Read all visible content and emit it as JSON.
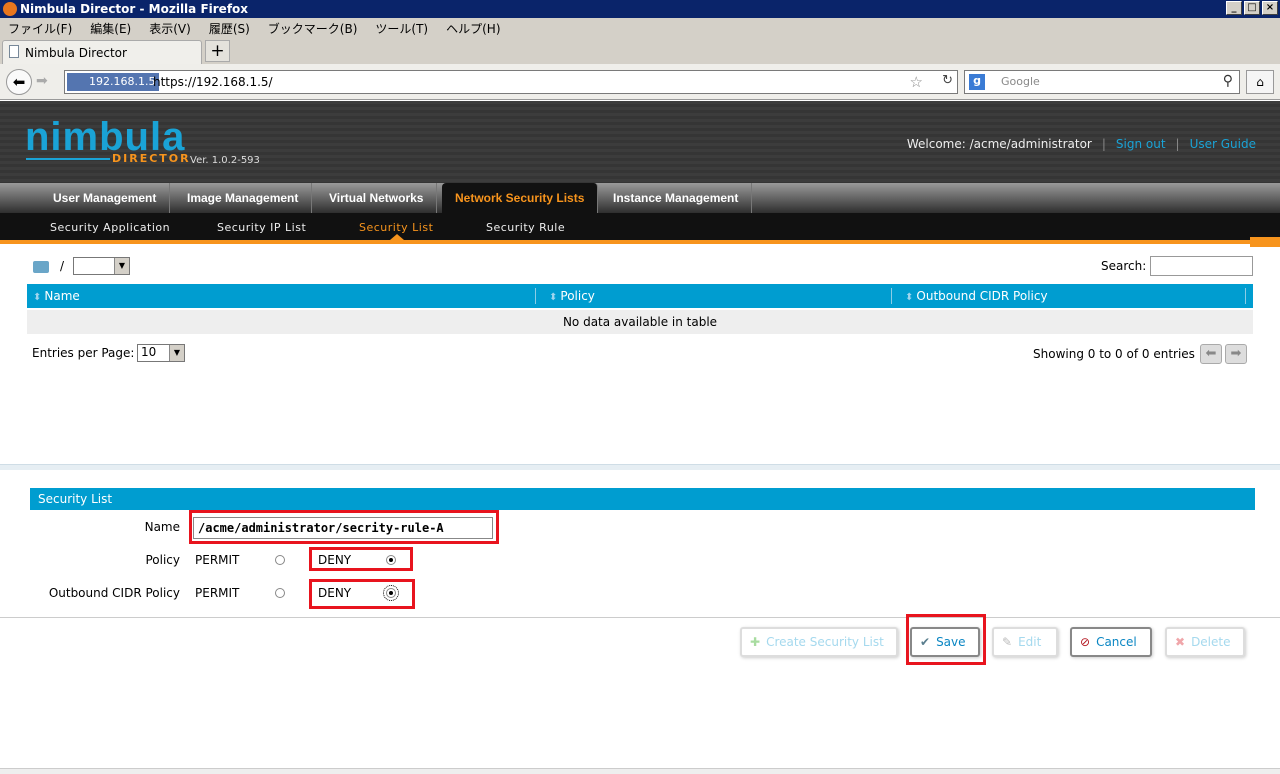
{
  "window": {
    "title": "Nimbula Director - Mozilla Firefox"
  },
  "menu": [
    "ファイル(F)",
    "編集(E)",
    "表示(V)",
    "履歴(S)",
    "ブックマーク(B)",
    "ツール(T)",
    "ヘルプ(H)"
  ],
  "tab": {
    "label": "Nimbula Director"
  },
  "nav": {
    "identity": "192.168.1.5",
    "url": "https://192.168.1.5/",
    "search_placeholder": "Google"
  },
  "app": {
    "logo": "nimbula",
    "logo_sub": "DIRECTOR",
    "version": "Ver. 1.0.2-593",
    "welcome": "Welcome: /acme/administrator",
    "sign_out": "Sign out",
    "user_guide": "User Guide"
  },
  "main_nav": [
    "User Management",
    "Image Management",
    "Virtual Networks",
    "Network Security Lists",
    "Instance Management"
  ],
  "sub_nav": [
    "Security Application",
    "Security IP List",
    "Security List",
    "Security Rule"
  ],
  "list": {
    "path_sep": "/",
    "search_label": "Search:",
    "columns": [
      "Name",
      "Policy",
      "Outbound CIDR Policy"
    ],
    "empty": "No data available in table",
    "entries_label": "Entries per Page:",
    "entries_value": "10",
    "showing": "Showing 0 to 0 of 0 entries"
  },
  "form": {
    "title": "Security List",
    "name_label": "Name",
    "name_value": "/acme/administrator/secrity-rule-A",
    "policy_label": "Policy",
    "outbound_label": "Outbound CIDR Policy",
    "permit": "PERMIT",
    "deny": "DENY",
    "policy_selected": "DENY",
    "outbound_selected": "DENY"
  },
  "buttons": {
    "create": "Create Security List",
    "save": "Save",
    "edit": "Edit",
    "cancel": "Cancel",
    "delete": "Delete"
  }
}
